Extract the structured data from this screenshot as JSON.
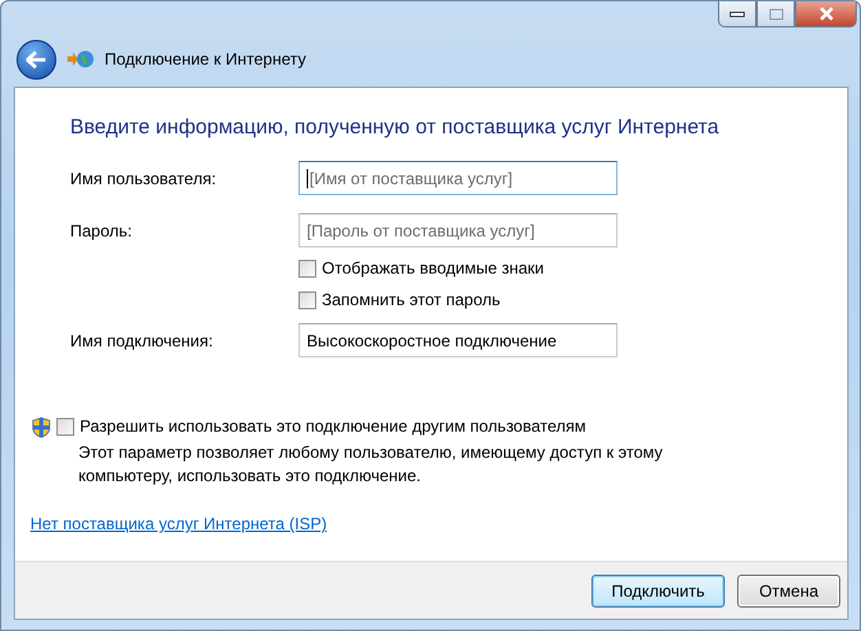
{
  "window": {
    "title": "Подключение к Интернету"
  },
  "heading": "Введите информацию, полученную от поставщика услуг Интернета",
  "fields": [
    {
      "label": "Имя пользователя:",
      "placeholder": "[Имя от поставщика услуг]",
      "focused": true
    },
    {
      "label": "Пароль:",
      "placeholder": "[Пароль от поставщика услуг]",
      "focused": false
    }
  ],
  "password_options": [
    {
      "label": "Отображать вводимые знаки",
      "checked": false
    },
    {
      "label": "Запомнить этот пароль",
      "checked": false
    }
  ],
  "connection_name": {
    "label": "Имя подключения:",
    "value": "Высокоскоростное подключение"
  },
  "allow_others": {
    "label": "Разрешить использовать это подключение другим пользователям",
    "checked": false,
    "description": "Этот параметр позволяет любому пользователю, имеющему доступ к этому компьютеру, использовать это подключение."
  },
  "link": "Нет поставщика услуг Интернета (ISP)",
  "buttons": [
    {
      "label": "Подключить",
      "default": true
    },
    {
      "label": "Отмена",
      "default": false
    }
  ]
}
